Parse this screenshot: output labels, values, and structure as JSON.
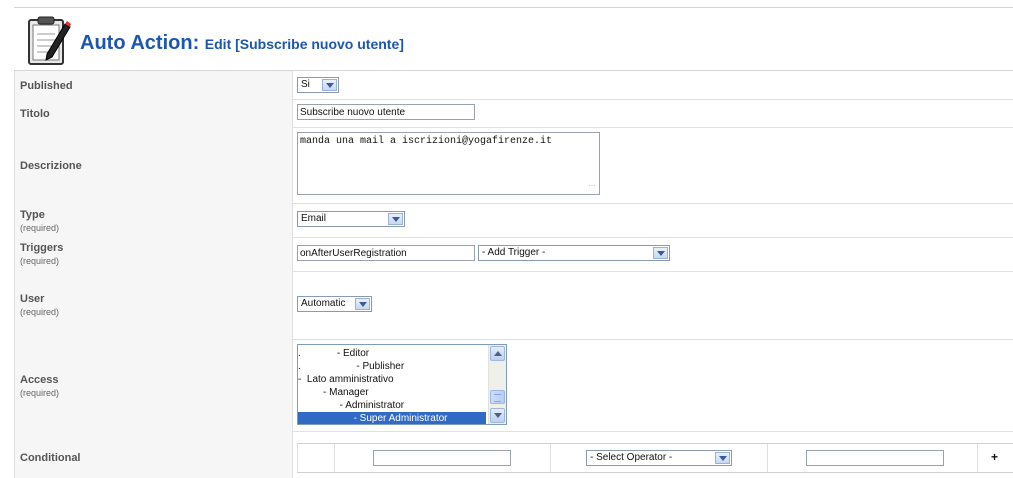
{
  "header": {
    "icon": "clipboard-pen-icon",
    "title": "Auto Action:",
    "subtitle": "Edit [Subscribe nuovo utente]",
    "accent_color": "#1b57b1"
  },
  "fields": {
    "published": {
      "label": "Published",
      "value": "Si"
    },
    "titolo": {
      "label": "Titolo",
      "value": "Subscribe nuovo utente"
    },
    "descrizione": {
      "label": "Descrizione",
      "value": "manda una mail a iscrizioni@yogafirenze.it"
    },
    "type": {
      "label": "Type",
      "required": "(required)",
      "value": "Email"
    },
    "triggers": {
      "label": "Triggers",
      "required": "(required)",
      "value": "onAfterUserRegistration",
      "add_select": "- Add Trigger -"
    },
    "user": {
      "label": "User",
      "required": "(required)",
      "value": "Automatic"
    },
    "access": {
      "label": "Access",
      "required": "(required)",
      "options": [
        ".             - Editor",
        ".                    - Publisher",
        "-  Lato amministrativo",
        "         - Manager",
        "               - Administrator",
        "                    - Super Administrator"
      ],
      "selected_index": 5
    },
    "conditional": {
      "label": "Conditional",
      "operator_placeholder": "- Select Operator -",
      "add_label": "+"
    }
  },
  "colors": {
    "selection": "#316ac5",
    "label_bg": "#f6f6f6"
  }
}
